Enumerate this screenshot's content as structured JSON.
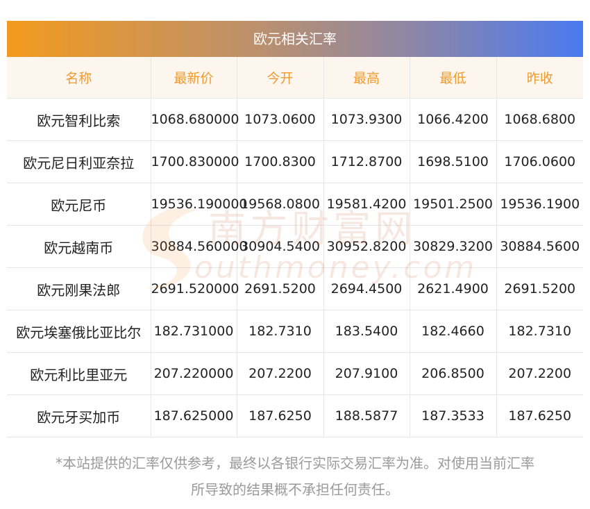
{
  "title": "欧元相关汇率",
  "headers": [
    "名称",
    "最新价",
    "今开",
    "最高",
    "最低",
    "昨收"
  ],
  "rows": [
    [
      "欧元智利比索",
      "1068.680000",
      "1073.0600",
      "1073.9300",
      "1066.4200",
      "1068.6800"
    ],
    [
      "欧元尼日利亚奈拉",
      "1700.830000",
      "1700.8300",
      "1712.8700",
      "1698.5100",
      "1706.0600"
    ],
    [
      "欧元尼币",
      "19536.190000",
      "19568.0800",
      "19581.4200",
      "19501.2500",
      "19536.1900"
    ],
    [
      "欧元越南币",
      "30884.560000",
      "30904.5400",
      "30952.8200",
      "30829.3200",
      "30884.5600"
    ],
    [
      "欧元刚果法郎",
      "2691.520000",
      "2691.5200",
      "2694.4500",
      "2621.4900",
      "2691.5200"
    ],
    [
      "欧元埃塞俄比亚比尔",
      "182.731000",
      "182.7310",
      "183.5400",
      "182.4660",
      "182.7310"
    ],
    [
      "欧元利比里亚元",
      "207.220000",
      "207.2200",
      "207.9100",
      "206.8500",
      "207.2200"
    ],
    [
      "欧元牙买加币",
      "187.625000",
      "187.6250",
      "188.5877",
      "187.3533",
      "187.6250"
    ]
  ],
  "watermark": {
    "cn": "南方财富网",
    "en": "outhmoney.com"
  },
  "note_line1": "*本站提供的汇率仅供参考，最终以各银行实际交易汇率为准。对使用当前汇率",
  "note_line2": "所导致的结果概不承担任何责任。"
}
